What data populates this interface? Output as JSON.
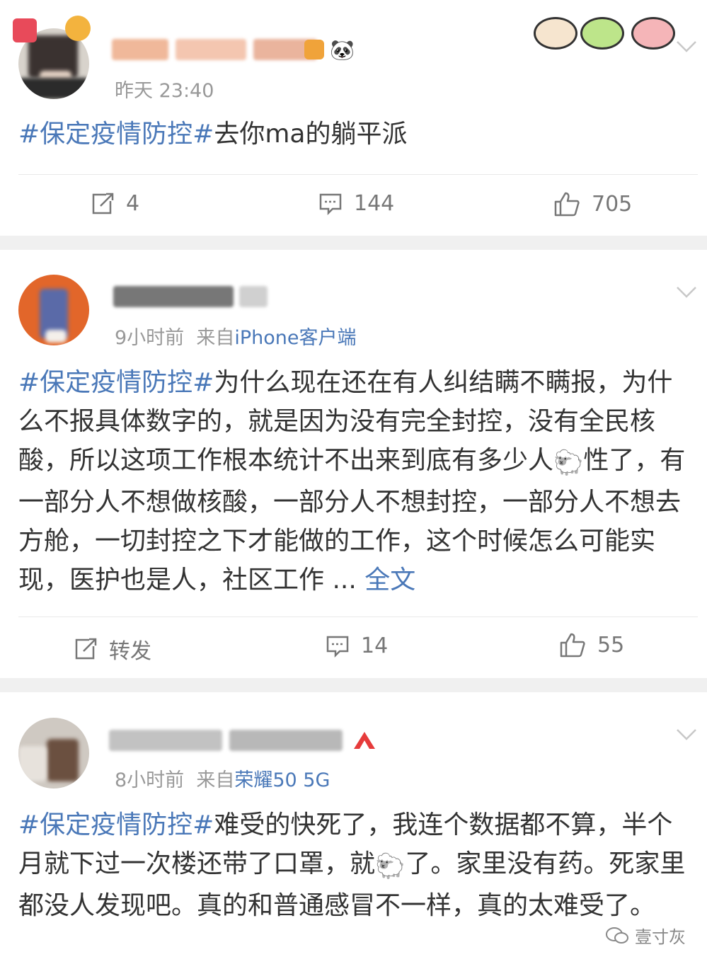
{
  "posts": [
    {
      "time": "昨天 23:40",
      "hashtag": "#保定疫情防控#",
      "text": "去你ma的躺平派",
      "more": "",
      "actions": {
        "repost": "4",
        "comment": "144",
        "like": "705"
      }
    },
    {
      "time": "9小时前",
      "source_prefix": "来自",
      "source": "iPhone客户端",
      "hashtag": "#保定疫情防控#",
      "text_a": "为什么现在还在有人纠结瞒不瞒报，为什么不报具体数字的，就是因为没有完全封控，没有全民核酸，所以这项工作根本统计不出来到底有多少人",
      "sheep": "🐑",
      "text_b": "性了，有一部分人不想做核酸，一部分人不想封控，一部分人不想去方舱，一切封控之下才能做的工作，这个时候怎么可能实现，医护也是人，社区工作 ... ",
      "more": "全文",
      "actions": {
        "repost": "转发",
        "comment": "14",
        "like": "55"
      }
    },
    {
      "time": "8小时前",
      "source_prefix": "来自",
      "source": "荣耀50 5G",
      "hashtag": "#保定疫情防控#",
      "text_a": "难受的快死了，我连个数据都不算，半个月就下过一次楼还带了口罩，就",
      "sheep": "🐑",
      "text_b": "了。家里没有药。死家里都没人发现吧。真的和普通感冒不一样，真的太难受了。"
    }
  ],
  "watermark": "壹寸灰",
  "colors": {
    "link": "#4a78b8",
    "meta": "#999999",
    "separator": "#f0f0f0"
  }
}
